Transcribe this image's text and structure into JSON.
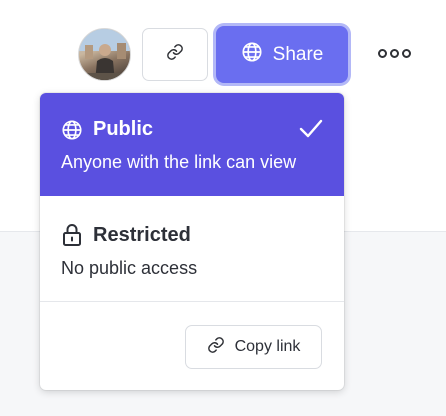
{
  "toolbar": {
    "avatar_alt": "User avatar",
    "share_label": "Share"
  },
  "sharing_menu": {
    "options": [
      {
        "title": "Public",
        "description": "Anyone with the link can view",
        "selected": true
      },
      {
        "title": "Restricted",
        "description": "No public access",
        "selected": false
      }
    ],
    "copy_link_label": "Copy link"
  },
  "colors": {
    "accent": "#6a6ef0",
    "selected_bg": "#5a50e0",
    "text": "#2d3038"
  },
  "icons": {
    "link": "link-icon",
    "globe": "globe-icon",
    "lock": "lock-icon",
    "check": "check-icon",
    "more": "more-icon"
  }
}
